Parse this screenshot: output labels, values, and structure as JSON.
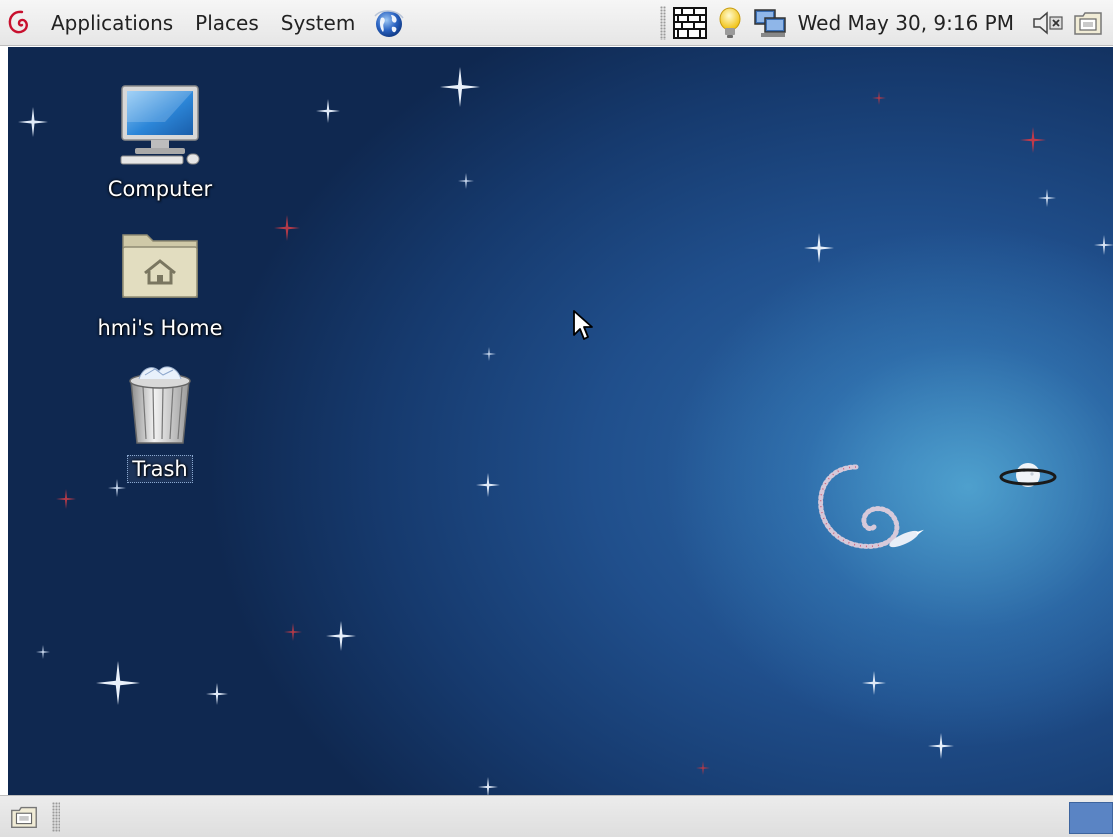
{
  "top_panel": {
    "menus": [
      "Applications",
      "Places",
      "System"
    ],
    "clock": "Wed May 30,  9:16 PM"
  },
  "desktop": {
    "icons": [
      {
        "label": "Computer",
        "icon": "computer-icon"
      },
      {
        "label": "hmi's Home",
        "icon": "home-folder-icon"
      },
      {
        "label": "Trash",
        "icon": "trash-icon",
        "selected": true
      }
    ]
  },
  "colors": {
    "panel": "#e9e9e9",
    "desktop_dark": "#0f2850",
    "desktop_glow": "#5ab4dc",
    "workspace_active": "#5a84c4"
  },
  "icons": {
    "menu_logo": "debian-swirl-icon",
    "launcher": "web-browser-globe-icon",
    "tray": [
      "firewall-brick-icon",
      "lightbulb-icon",
      "network-icon",
      "volume-icon",
      "show-desktop-icon"
    ]
  }
}
